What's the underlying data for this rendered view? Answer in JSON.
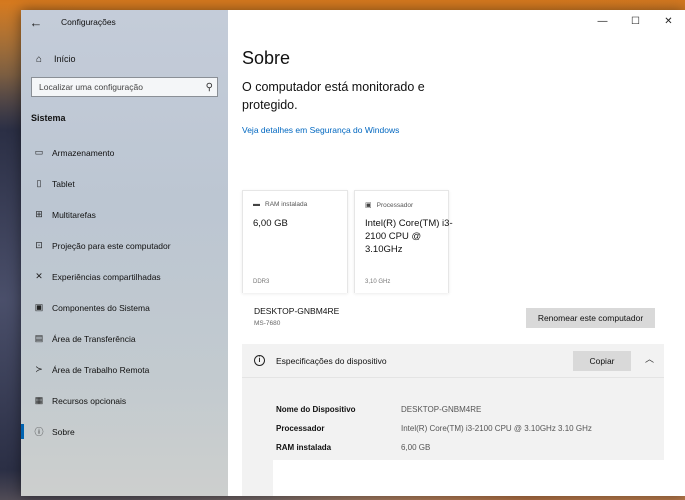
{
  "window": {
    "title": "Configurações",
    "back_glyph": "←",
    "controls": {
      "minimize": "—",
      "maximize": "☐",
      "close": "✕"
    }
  },
  "sidebar": {
    "home_label": "Início",
    "search_placeholder": "Localizar uma configuração",
    "section_title": "Sistema",
    "items": [
      {
        "label": "Armazenamento",
        "icon": "storage-icon",
        "glyph": "▭"
      },
      {
        "label": "Tablet",
        "icon": "tablet-icon",
        "glyph": "▯"
      },
      {
        "label": "Multitarefas",
        "icon": "multitasking-icon",
        "glyph": "⊞"
      },
      {
        "label": "Projeção para este computador",
        "icon": "projection-icon",
        "glyph": "⊡"
      },
      {
        "label": "Experiências compartilhadas",
        "icon": "shared-experiences-icon",
        "glyph": "✕"
      },
      {
        "label": "Componentes do Sistema",
        "icon": "system-components-icon",
        "glyph": "▣"
      },
      {
        "label": "Área de Transferência",
        "icon": "clipboard-icon",
        "glyph": "▤"
      },
      {
        "label": "Área de Trabalho Remota",
        "icon": "remote-desktop-icon",
        "glyph": "≻"
      },
      {
        "label": "Recursos opcionais",
        "icon": "optional-features-icon",
        "glyph": "▦"
      },
      {
        "label": "Sobre",
        "icon": "info-icon",
        "glyph": "ⓘ",
        "active": true
      }
    ]
  },
  "main": {
    "title": "Sobre",
    "status": "O computador está monitorado e protegido.",
    "security_link": "Veja detalhes em Segurança do Windows",
    "cards": [
      {
        "label": "RAM instalada",
        "value": "6,00 GB",
        "footer": "DDR3",
        "icon": "memory-icon",
        "glyph": "▬"
      },
      {
        "label": "Processador",
        "value": "Intel(R) Core(TM) i3-2100 CPU @ 3.10GHz",
        "footer": "3,10 GHz",
        "icon": "processor-icon",
        "glyph": "▣"
      }
    ],
    "device": {
      "name": "DESKTOP-GNBM4RE",
      "model": "MS-7680",
      "rename_button": "Renomear este computador"
    },
    "specs": {
      "title": "Especificações do dispositivo",
      "info_glyph": "i",
      "copy_button": "Copiar",
      "chevron_glyph": "︿",
      "rows": [
        {
          "key": "Nome do Dispositivo",
          "value": "DESKTOP-GNBM4RE"
        },
        {
          "key": "Processador",
          "value": "Intel(R) Core(TM) i3-2100 CPU @ 3.10GHz   3.10 GHz"
        },
        {
          "key": "RAM instalada",
          "value": "6,00 GB"
        }
      ]
    }
  }
}
